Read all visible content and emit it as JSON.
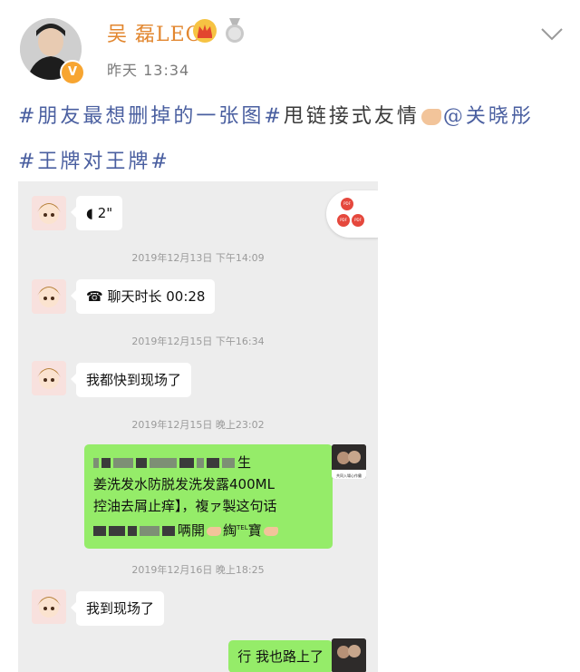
{
  "header": {
    "username": "吴 磊LEO",
    "time": "昨天 13:34",
    "avatar_badge": "V"
  },
  "post": {
    "tag1": "#朋友最想删掉的一张图#",
    "text1": "甩链接式友情",
    "mention": "@关晓彤",
    "tag2": "#王牌对王牌#"
  },
  "chat": {
    "msg_voice": "2\"",
    "ts1": "2019年12月13日 下午14:09",
    "msg_call": "聊天时长 00:28",
    "ts2": "2019年12月15日 下午16:34",
    "msg1": "我都快到现场了",
    "ts3": "2019年12月15日 晚上23:02",
    "green_line1_tail": "生",
    "green_line2": "姜洗发水防脱发洗发露400ML",
    "green_line3": "控油去屑止痒】，複ァ製这句话",
    "green_line4_mid": "唡開",
    "green_line4_tail": "綯",
    "green_line4_sup": "TEL",
    "green_line4_end": "寶",
    "ts4": "2019年12月16日 晚上18:25",
    "msg2": "我到现场了",
    "green_bottom": "行 我也路上了",
    "pdf_label": "PDF",
    "right_avatar_caption": "共同入場心作攤"
  },
  "icons": {
    "crown": "crown-icon",
    "medal": "medal-icon",
    "chevron": "chevron-down-icon",
    "voice": "voice-icon",
    "phone": "phone-icon",
    "hand": "pointing-hand-icon"
  },
  "colors": {
    "username": "#e2862e",
    "hashtag": "#4a5fa0",
    "green_bubble": "#95ec69",
    "chat_bg": "#ededed"
  }
}
